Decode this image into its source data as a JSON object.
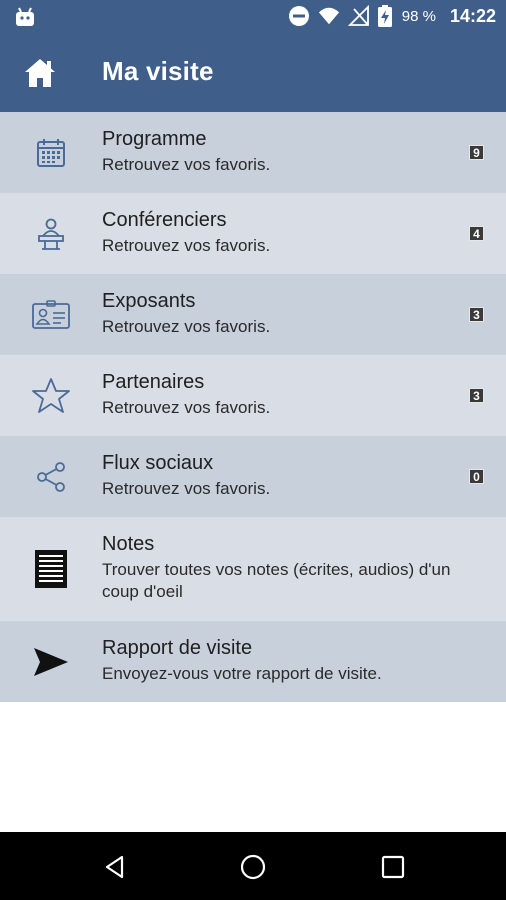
{
  "status_bar": {
    "battery_percent": "98 %",
    "time": "14:22",
    "icons": [
      "android-icon",
      "do-not-disturb-icon",
      "wifi-icon",
      "no-signal-icon",
      "battery-charging-icon"
    ]
  },
  "app_bar": {
    "title": "Ma visite",
    "home_icon": "home-icon",
    "background": "#3f5f8a"
  },
  "menu": {
    "items": [
      {
        "title": "Programme",
        "subtitle": "Retrouvez vos favoris.",
        "count": "9",
        "icon": "calendar-icon"
      },
      {
        "title": "Conférenciers",
        "subtitle": "Retrouvez vos favoris.",
        "count": "4",
        "icon": "speaker-podium-icon"
      },
      {
        "title": "Exposants",
        "subtitle": "Retrouvez vos favoris.",
        "count": "3",
        "icon": "id-card-icon"
      },
      {
        "title": "Partenaires",
        "subtitle": "Retrouvez vos favoris.",
        "count": "3",
        "icon": "star-icon"
      },
      {
        "title": "Flux sociaux",
        "subtitle": "Retrouvez vos favoris.",
        "count": "0",
        "icon": "share-icon"
      },
      {
        "title": "Notes",
        "subtitle": "Trouver toutes vos notes (écrites, audios) d'un coup d'oeil",
        "icon": "notes-icon"
      },
      {
        "title": "Rapport de visite",
        "subtitle": "Envoyez-vous votre rapport de visite.",
        "icon": "send-icon"
      }
    ],
    "row_colors": {
      "dark": "#c8d0db",
      "light": "#d9dee6"
    }
  },
  "nav_bar": {
    "buttons": [
      "back-icon",
      "home-circle-icon",
      "recents-icon"
    ]
  }
}
